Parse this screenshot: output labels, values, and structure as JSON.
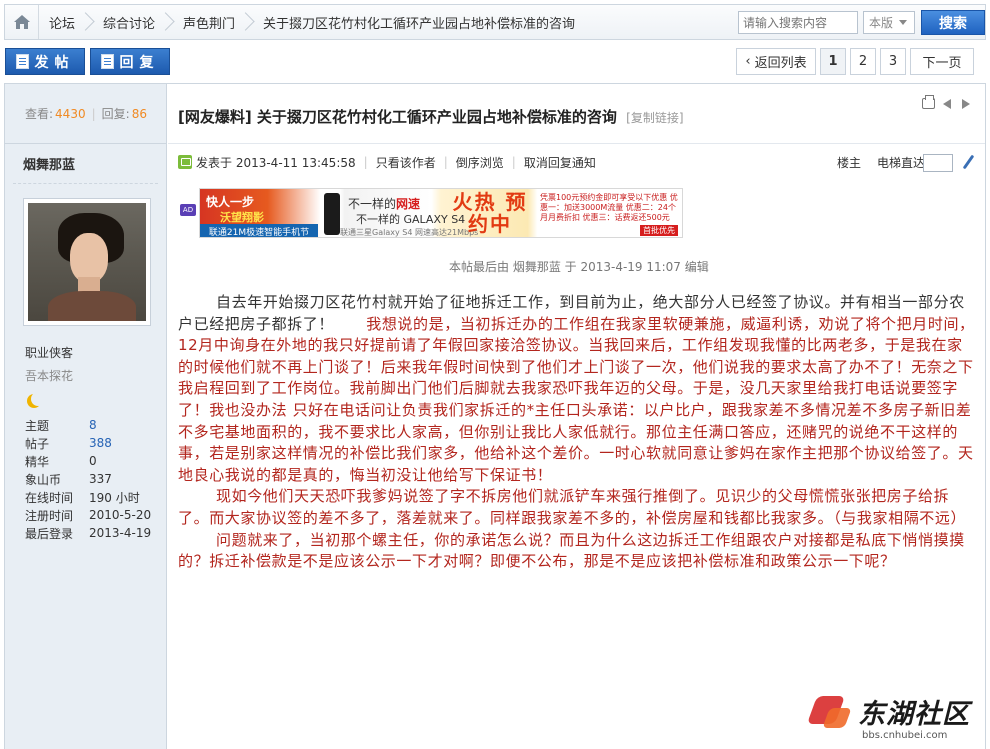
{
  "breadcrumb": {
    "items": [
      "论坛",
      "综合讨论",
      "声色荆门",
      "关于掇刀区花竹村化工循环产业园占地补偿标准的咨询"
    ]
  },
  "search": {
    "placeholder": "请输入搜索内容",
    "scope": "本版",
    "button": "搜索"
  },
  "actions": {
    "post": "发帖",
    "reply": "回复"
  },
  "pager": {
    "back": "返回列表",
    "pages": [
      "1",
      "2",
      "3"
    ],
    "current": "1",
    "next": "下一页"
  },
  "sidebar": {
    "views_label": "查看:",
    "views": "4430",
    "replies_label": "回复:",
    "replies": "86",
    "author": "烟舞那蓝",
    "group": "职业侠客",
    "subtitle": "吾本探花",
    "profile": [
      {
        "k": "主题",
        "v": "8",
        "link": true
      },
      {
        "k": "帖子",
        "v": "388",
        "link": true
      },
      {
        "k": "精华",
        "v": "0",
        "link": false
      },
      {
        "k": "象山币",
        "v": "337",
        "link": false
      },
      {
        "k": "在线时间",
        "v": "190 小时",
        "link": false
      },
      {
        "k": "注册时间",
        "v": "2010-5-20",
        "link": false
      },
      {
        "k": "最后登录",
        "v": "2013-4-19",
        "link": false
      }
    ]
  },
  "post": {
    "title": "[网友爆料] 关于掇刀区花竹村化工循环产业园占地补偿标准的咨询",
    "copy_link": "[复制链接]",
    "posted_at": "发表于 2013-4-11 13:45:58",
    "only_author": "只看该作者",
    "reverse": "倒序浏览",
    "cancel_notify": "取消回复通知",
    "floor": "楼主",
    "elevator": "电梯直达",
    "edited": "本帖最后由 烟舞那蓝 于 2013-4-19 11:07 编辑",
    "ad": {
      "badge": "AD",
      "left1": "快人一步",
      "left2": "沃望翔影",
      "left3": "联通21M极速智能手机节",
      "mid1a": "不一样的",
      "mid1b": "网速",
      "mid2": "不一样的 GALAXY S4",
      "mid3": "联通三星Galaxy S4 网速高达21Mbps",
      "hot": "火热 预约中",
      "right": "凭票100元预约金即可享受以下优惠 优惠一：加送3000M流量 优惠二：24个月月费折扣 优惠三：话费返还500元",
      "right2": "首批优先办理"
    },
    "p1_black": "自去年开始掇刀区花竹村就开始了征地拆迁工作，到目前为止，绝大部分人已经签了协议。并有相当一部分农户已经把房子都拆了！",
    "p1_red": "我想说的是，当初拆迁办的工作组在我家里软硬兼施，威逼利诱，劝说了将个把月时间，12月中询身在外地的我只好提前请了年假回家接洽签协议。当我回来后，工作组发现我懂的比两老多，于是我在家的时候他们就不再上门谈了！后来我年假时间快到了他们才上门谈了一次，他们说我的要求太高了办不了！无奈之下我启程回到了工作岗位。我前脚出门他们后脚就去我家恐吓我年迈的父母。于是，没几天家里给我打电话说要签字了！我也没办法 只好在电话问让负责我们家拆迁的*主任口头承诺：以户比户，跟我家差不多情况差不多房子新旧差不多宅基地面积的，我不要求比人家高，但你别让我比人家低就行。那位主任满口答应，还赌咒的说绝不干这样的事，若是别家这样情况的补偿比我们家多，他给补这个差价。一时心软就同意让爹妈在家作主把那个协议给签了。天地良心我说的都是真的，悔当初没让他给写下保证书！",
    "p2": "现如今他们天天恐吓我爹妈说签了字不拆房他们就派铲车来强行推倒了。见识少的父母慌慌张张把房子给拆了。而大家协议签的差不多了，落差就来了。同样跟我家差不多的，补偿房屋和钱都比我家多。（与我家相隔不远）",
    "p3": "问题就来了，当初那个螺主任，你的承诺怎么说？而且为什么这边拆迁工作组跟农户对接都是私底下悄悄摸摸的？拆迁补偿款是不是应该公示一下才对啊？即便不公布，那是不是应该把补偿标准和政策公示一下呢？"
  },
  "watermark": {
    "brand": "东湖社区",
    "url": "bbs.cnhubei.com"
  },
  "colors": {
    "accent_blue": "#1f62c0",
    "body_red": "#b3261e",
    "stat_orange": "#f08a24",
    "sidebar_bg": "#e8eef4"
  }
}
